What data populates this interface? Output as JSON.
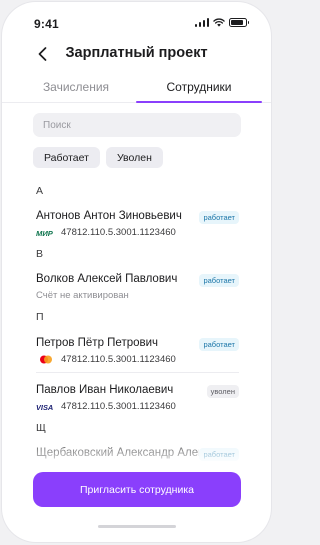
{
  "status_bar": {
    "time": "9:41",
    "battery_level": 0.85
  },
  "header": {
    "title": "Зарплатный проект",
    "back_icon": "chevron-left-icon"
  },
  "tabs": [
    {
      "label": "Зачисления",
      "active": false
    },
    {
      "label": "Сотрудники",
      "active": true
    }
  ],
  "search": {
    "placeholder": "Поиск"
  },
  "filters": [
    "Работает",
    "Уволен"
  ],
  "sections": [
    {
      "letter": "А"
    },
    {
      "letter": "В"
    },
    {
      "letter": "П"
    },
    {
      "letter": "Щ"
    }
  ],
  "employees": [
    {
      "name": "Антонов Антон Зиновьевич",
      "card_system": "МИР",
      "card_number": "47812.110.5.3001.1123460",
      "status": "работает"
    },
    {
      "name": "Волков Алексей Павлович",
      "note": "Счёт не активирован",
      "status": "работает"
    },
    {
      "name": "Петров Пётр Петрович",
      "card_system": "Mastercard",
      "card_number": "47812.110.5.3001.1123460",
      "status": "работает"
    },
    {
      "name": "Павлов Иван Николаевич",
      "card_system": "VISA",
      "card_number": "47812.110.5.3001.1123460",
      "status": "уволен"
    },
    {
      "name": "Щербаковский Александр Александрович",
      "status": "работает"
    }
  ],
  "invite_button": {
    "label": "Пригласить сотрудника"
  },
  "colors": {
    "accent": "#8a3ffc",
    "badge_working": "#1c76a8",
    "mir": "#0f754e",
    "visa": "#1a1f71",
    "mc_red": "#eb001b",
    "mc_orange": "#f79e1b"
  }
}
